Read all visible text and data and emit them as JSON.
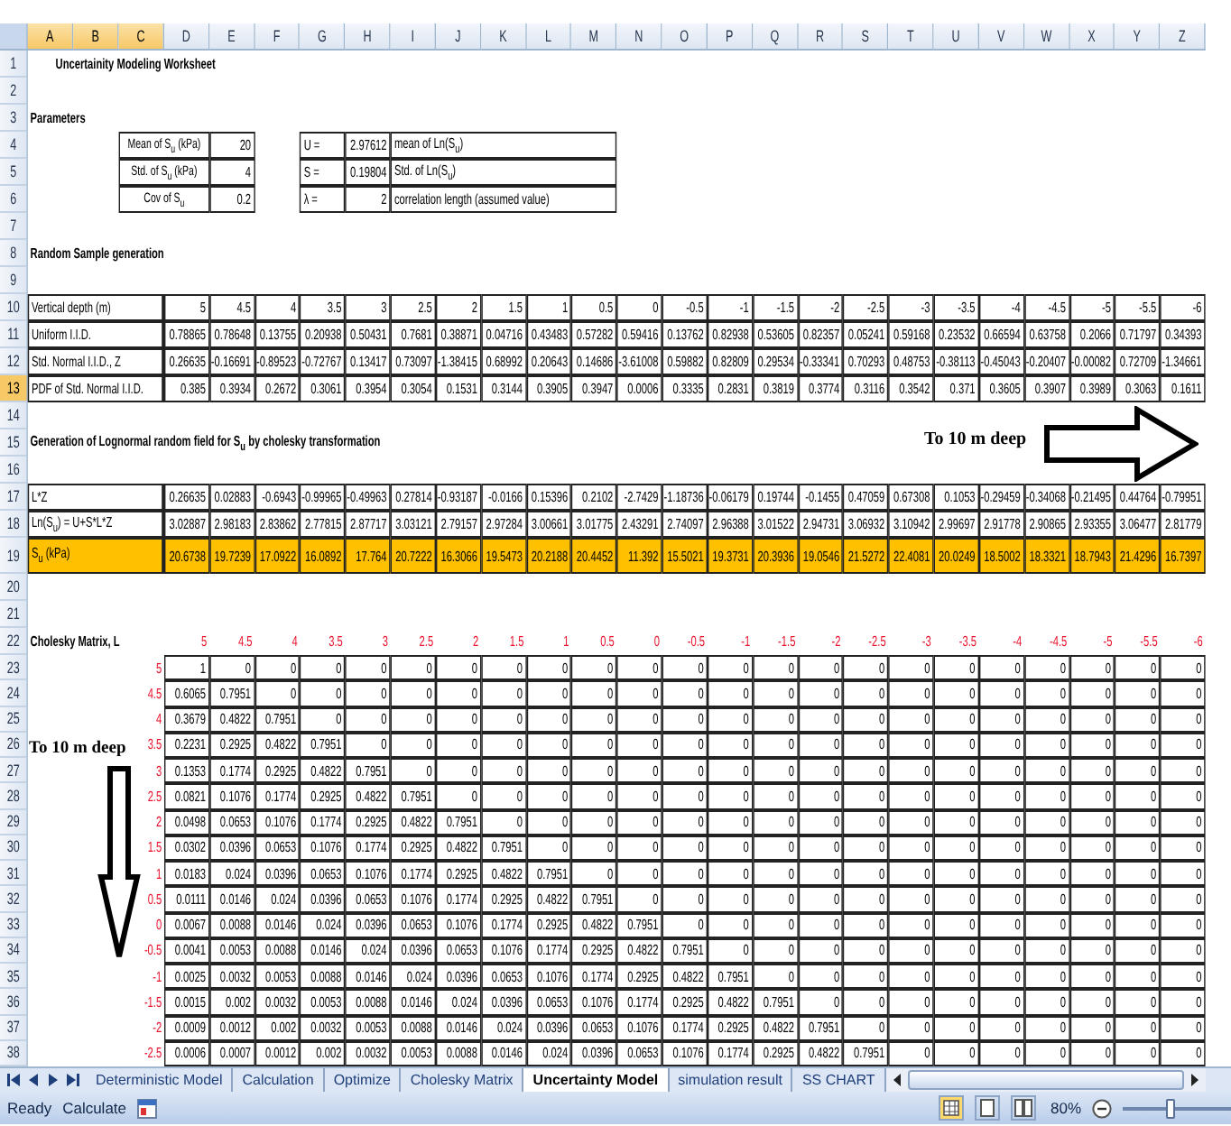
{
  "columns": [
    {
      "label": "A",
      "selected": true
    },
    {
      "label": "B",
      "selected": true
    },
    {
      "label": "C",
      "selected": true
    },
    {
      "label": "D",
      "selected": false
    },
    {
      "label": "E",
      "selected": false
    },
    {
      "label": "F",
      "selected": false
    },
    {
      "label": "G",
      "selected": false
    },
    {
      "label": "H",
      "selected": false
    },
    {
      "label": "I",
      "selected": false
    },
    {
      "label": "J",
      "selected": false
    },
    {
      "label": "K",
      "selected": false
    },
    {
      "label": "L",
      "selected": false
    },
    {
      "label": "M",
      "selected": false
    },
    {
      "label": "N",
      "selected": false
    },
    {
      "label": "O",
      "selected": false
    },
    {
      "label": "P",
      "selected": false
    },
    {
      "label": "Q",
      "selected": false
    },
    {
      "label": "R",
      "selected": false
    },
    {
      "label": "S",
      "selected": false
    },
    {
      "label": "T",
      "selected": false
    },
    {
      "label": "U",
      "selected": false
    },
    {
      "label": "V",
      "selected": false
    },
    {
      "label": "W",
      "selected": false
    },
    {
      "label": "X",
      "selected": false
    },
    {
      "label": "Y",
      "selected": false
    },
    {
      "label": "Z",
      "selected": false
    }
  ],
  "rows": [
    {
      "number": "1",
      "selected": false,
      "kind": "title",
      "text": "Uncertainity Modeling Worksheet"
    },
    {
      "number": "2",
      "selected": false,
      "kind": "blank"
    },
    {
      "number": "3",
      "selected": false,
      "kind": "section",
      "text": "Parameters"
    },
    {
      "number": "4",
      "selected": false,
      "kind": "params",
      "label": "Mean of S$_{u}$ (kPa)",
      "value": "20",
      "symbol": "U =",
      "symbol_value": "2.97612",
      "note": "mean of Ln(S$_{u}$)"
    },
    {
      "number": "5",
      "selected": false,
      "kind": "params",
      "label": "Std. of S$_{u}$ (kPa)",
      "value": "4",
      "symbol": "S =",
      "symbol_value": "0.19804",
      "note": "Std. of Ln(S$_{u}$)"
    },
    {
      "number": "6",
      "selected": false,
      "kind": "params",
      "label": "Cov of S$_{u}$",
      "value": "0.2",
      "symbol": "λ =",
      "symbol_value": "2",
      "note": "correlation length (assumed value)"
    },
    {
      "number": "7",
      "selected": false,
      "kind": "blank"
    },
    {
      "number": "8",
      "selected": false,
      "kind": "section",
      "text": "Random Sample generation"
    },
    {
      "number": "9",
      "selected": false,
      "kind": "blank"
    },
    {
      "number": "10",
      "selected": false,
      "kind": "data",
      "highlight": false,
      "label": "Vertical depth (m)",
      "values": [
        "5",
        "4.5",
        "4",
        "3.5",
        "3",
        "2.5",
        "2",
        "1.5",
        "1",
        "0.5",
        "0",
        "-0.5",
        "-1",
        "-1.5",
        "-2",
        "-2.5",
        "-3",
        "-3.5",
        "-4",
        "-4.5",
        "-5",
        "-5.5",
        "-6"
      ]
    },
    {
      "number": "11",
      "selected": false,
      "kind": "data",
      "highlight": false,
      "label": "Uniform I.I.D.",
      "values": [
        "0.78865",
        "0.78648",
        "0.13755",
        "0.20938",
        "0.50431",
        "0.7681",
        "0.38871",
        "0.04716",
        "0.43483",
        "0.57282",
        "0.59416",
        "0.13762",
        "0.82938",
        "0.53605",
        "0.82357",
        "0.05241",
        "0.59168",
        "0.23532",
        "0.66594",
        "0.63758",
        "0.2066",
        "0.71797",
        "0.34393"
      ]
    },
    {
      "number": "12",
      "selected": false,
      "kind": "data",
      "highlight": false,
      "label": "Std. Normal I.I.D., Z",
      "values": [
        "0.26635",
        "-0.16691",
        "-0.89523",
        "-0.72767",
        "0.13417",
        "0.73097",
        "-1.38415",
        "0.68992",
        "0.20643",
        "0.14686",
        "-3.61008",
        "0.59882",
        "0.82809",
        "0.29534",
        "-0.33341",
        "0.70293",
        "0.48753",
        "-0.38113",
        "-0.45043",
        "-0.20407",
        "-0.00082",
        "0.72709",
        "-1.34661"
      ]
    },
    {
      "number": "13",
      "selected": true,
      "kind": "data",
      "highlight": false,
      "label": "PDF of Std. Normal I.I.D.",
      "values": [
        "0.385",
        "0.3934",
        "0.2672",
        "0.3061",
        "0.3954",
        "0.3054",
        "0.1531",
        "0.3144",
        "0.3905",
        "0.3947",
        "0.0006",
        "0.3335",
        "0.2831",
        "0.3819",
        "0.3774",
        "0.3116",
        "0.3542",
        "0.371",
        "0.3605",
        "0.3907",
        "0.3989",
        "0.3063",
        "0.1611"
      ]
    },
    {
      "number": "14",
      "selected": false,
      "kind": "blank"
    },
    {
      "number": "15",
      "selected": false,
      "kind": "section",
      "text": "Generation of Lognormal random field for S$_{u}$ by cholesky transformation"
    },
    {
      "number": "16",
      "selected": false,
      "kind": "blank"
    },
    {
      "number": "17",
      "selected": false,
      "kind": "data",
      "highlight": false,
      "label": "L*Z",
      "values": [
        "0.26635",
        "0.02883",
        "-0.6943",
        "-0.99965",
        "-0.49963",
        "0.27814",
        "-0.93187",
        "-0.0166",
        "0.15396",
        "0.2102",
        "-2.7429",
        "-1.18736",
        "-0.06179",
        "0.19744",
        "-0.1455",
        "0.47059",
        "0.67308",
        "0.1053",
        "-0.29459",
        "-0.34068",
        "-0.21495",
        "0.44764",
        "-0.79951"
      ]
    },
    {
      "number": "18",
      "selected": false,
      "kind": "data",
      "highlight": false,
      "label": "Ln(S$_{u}$) = U+S*L*Z",
      "values": [
        "3.02887",
        "2.98183",
        "2.83862",
        "2.77815",
        "2.87717",
        "3.03121",
        "2.79157",
        "2.97284",
        "3.00661",
        "3.01775",
        "2.43291",
        "2.74097",
        "2.96388",
        "3.01522",
        "2.94731",
        "3.06932",
        "3.10942",
        "2.99697",
        "2.91778",
        "2.90865",
        "2.93355",
        "3.06477",
        "2.81779"
      ]
    },
    {
      "number": "19",
      "selected": false,
      "kind": "data",
      "highlight": true,
      "label": "S$_{u}$ (kPa)",
      "values": [
        "20.6738",
        "19.7239",
        "17.0922",
        "16.0892",
        "17.764",
        "20.7222",
        "16.3066",
        "19.5473",
        "20.2188",
        "20.4452",
        "11.392",
        "15.5021",
        "19.3731",
        "20.3936",
        "19.0546",
        "21.5272",
        "22.4081",
        "20.0249",
        "18.5002",
        "18.3321",
        "18.7943",
        "21.4296",
        "16.7397"
      ]
    },
    {
      "number": "20",
      "selected": false,
      "kind": "blank"
    },
    {
      "number": "21",
      "selected": false,
      "kind": "blank"
    },
    {
      "number": "22",
      "selected": false,
      "kind": "depths",
      "label": "Cholesky Matrix, L",
      "values": [
        "5",
        "4.5",
        "4",
        "3.5",
        "3",
        "2.5",
        "2",
        "1.5",
        "1",
        "0.5",
        "0",
        "-0.5",
        "-1",
        "-1.5",
        "-2",
        "-2.5",
        "-3",
        "-3.5",
        "-4",
        "-4.5",
        "-5",
        "-5.5",
        "-6"
      ]
    },
    {
      "number": "23",
      "selected": false,
      "kind": "matrix",
      "depth": "5",
      "values": [
        "1",
        "0",
        "0",
        "0",
        "0",
        "0",
        "0",
        "0",
        "0",
        "0",
        "0",
        "0",
        "0",
        "0",
        "0",
        "0",
        "0",
        "0",
        "0",
        "0",
        "0",
        "0",
        "0"
      ]
    },
    {
      "number": "24",
      "selected": false,
      "kind": "matrix",
      "depth": "4.5",
      "values": [
        "0.6065",
        "0.7951",
        "0",
        "0",
        "0",
        "0",
        "0",
        "0",
        "0",
        "0",
        "0",
        "0",
        "0",
        "0",
        "0",
        "0",
        "0",
        "0",
        "0",
        "0",
        "0",
        "0",
        "0"
      ]
    },
    {
      "number": "25",
      "selected": false,
      "kind": "matrix",
      "depth": "4",
      "values": [
        "0.3679",
        "0.4822",
        "0.7951",
        "0",
        "0",
        "0",
        "0",
        "0",
        "0",
        "0",
        "0",
        "0",
        "0",
        "0",
        "0",
        "0",
        "0",
        "0",
        "0",
        "0",
        "0",
        "0",
        "0"
      ]
    },
    {
      "number": "26",
      "selected": false,
      "kind": "matrix",
      "depth": "3.5",
      "values": [
        "0.2231",
        "0.2925",
        "0.4822",
        "0.7951",
        "0",
        "0",
        "0",
        "0",
        "0",
        "0",
        "0",
        "0",
        "0",
        "0",
        "0",
        "0",
        "0",
        "0",
        "0",
        "0",
        "0",
        "0",
        "0"
      ]
    },
    {
      "number": "27",
      "selected": false,
      "kind": "matrix",
      "depth": "3",
      "values": [
        "0.1353",
        "0.1774",
        "0.2925",
        "0.4822",
        "0.7951",
        "0",
        "0",
        "0",
        "0",
        "0",
        "0",
        "0",
        "0",
        "0",
        "0",
        "0",
        "0",
        "0",
        "0",
        "0",
        "0",
        "0",
        "0"
      ]
    },
    {
      "number": "28",
      "selected": false,
      "kind": "matrix",
      "depth": "2.5",
      "values": [
        "0.0821",
        "0.1076",
        "0.1774",
        "0.2925",
        "0.4822",
        "0.7951",
        "0",
        "0",
        "0",
        "0",
        "0",
        "0",
        "0",
        "0",
        "0",
        "0",
        "0",
        "0",
        "0",
        "0",
        "0",
        "0",
        "0"
      ]
    },
    {
      "number": "29",
      "selected": false,
      "kind": "matrix",
      "depth": "2",
      "values": [
        "0.0498",
        "0.0653",
        "0.1076",
        "0.1774",
        "0.2925",
        "0.4822",
        "0.7951",
        "0",
        "0",
        "0",
        "0",
        "0",
        "0",
        "0",
        "0",
        "0",
        "0",
        "0",
        "0",
        "0",
        "0",
        "0",
        "0"
      ]
    },
    {
      "number": "30",
      "selected": false,
      "kind": "matrix",
      "depth": "1.5",
      "values": [
        "0.0302",
        "0.0396",
        "0.0653",
        "0.1076",
        "0.1774",
        "0.2925",
        "0.4822",
        "0.7951",
        "0",
        "0",
        "0",
        "0",
        "0",
        "0",
        "0",
        "0",
        "0",
        "0",
        "0",
        "0",
        "0",
        "0",
        "0"
      ]
    },
    {
      "number": "31",
      "selected": false,
      "kind": "matrix",
      "depth": "1",
      "values": [
        "0.0183",
        "0.024",
        "0.0396",
        "0.0653",
        "0.1076",
        "0.1774",
        "0.2925",
        "0.4822",
        "0.7951",
        "0",
        "0",
        "0",
        "0",
        "0",
        "0",
        "0",
        "0",
        "0",
        "0",
        "0",
        "0",
        "0",
        "0"
      ]
    },
    {
      "number": "32",
      "selected": false,
      "kind": "matrix",
      "depth": "0.5",
      "values": [
        "0.0111",
        "0.0146",
        "0.024",
        "0.0396",
        "0.0653",
        "0.1076",
        "0.1774",
        "0.2925",
        "0.4822",
        "0.7951",
        "0",
        "0",
        "0",
        "0",
        "0",
        "0",
        "0",
        "0",
        "0",
        "0",
        "0",
        "0",
        "0"
      ]
    },
    {
      "number": "33",
      "selected": false,
      "kind": "matrix",
      "depth": "0",
      "values": [
        "0.0067",
        "0.0088",
        "0.0146",
        "0.024",
        "0.0396",
        "0.0653",
        "0.1076",
        "0.1774",
        "0.2925",
        "0.4822",
        "0.7951",
        "0",
        "0",
        "0",
        "0",
        "0",
        "0",
        "0",
        "0",
        "0",
        "0",
        "0",
        "0"
      ]
    },
    {
      "number": "34",
      "selected": false,
      "kind": "matrix",
      "depth": "-0.5",
      "values": [
        "0.0041",
        "0.0053",
        "0.0088",
        "0.0146",
        "0.024",
        "0.0396",
        "0.0653",
        "0.1076",
        "0.1774",
        "0.2925",
        "0.4822",
        "0.7951",
        "0",
        "0",
        "0",
        "0",
        "0",
        "0",
        "0",
        "0",
        "0",
        "0",
        "0"
      ]
    },
    {
      "number": "35",
      "selected": false,
      "kind": "matrix",
      "depth": "-1",
      "values": [
        "0.0025",
        "0.0032",
        "0.0053",
        "0.0088",
        "0.0146",
        "0.024",
        "0.0396",
        "0.0653",
        "0.1076",
        "0.1774",
        "0.2925",
        "0.4822",
        "0.7951",
        "0",
        "0",
        "0",
        "0",
        "0",
        "0",
        "0",
        "0",
        "0",
        "0"
      ]
    },
    {
      "number": "36",
      "selected": false,
      "kind": "matrix",
      "depth": "-1.5",
      "values": [
        "0.0015",
        "0.002",
        "0.0032",
        "0.0053",
        "0.0088",
        "0.0146",
        "0.024",
        "0.0396",
        "0.0653",
        "0.1076",
        "0.1774",
        "0.2925",
        "0.4822",
        "0.7951",
        "0",
        "0",
        "0",
        "0",
        "0",
        "0",
        "0",
        "0",
        "0"
      ]
    },
    {
      "number": "37",
      "selected": false,
      "kind": "matrix",
      "depth": "-2",
      "values": [
        "0.0009",
        "0.0012",
        "0.002",
        "0.0032",
        "0.0053",
        "0.0088",
        "0.0146",
        "0.024",
        "0.0396",
        "0.0653",
        "0.1076",
        "0.1774",
        "0.2925",
        "0.4822",
        "0.7951",
        "0",
        "0",
        "0",
        "0",
        "0",
        "0",
        "0",
        "0"
      ]
    },
    {
      "number": "38",
      "selected": false,
      "kind": "matrix",
      "depth": "-2.5",
      "values": [
        "0.0006",
        "0.0007",
        "0.0012",
        "0.002",
        "0.0032",
        "0.0053",
        "0.0088",
        "0.0146",
        "0.024",
        "0.0396",
        "0.0653",
        "0.1076",
        "0.1774",
        "0.2925",
        "0.4822",
        "0.7951",
        "0",
        "0",
        "0",
        "0",
        "0",
        "0",
        "0"
      ]
    }
  ],
  "annotations": [
    {
      "kind": "right",
      "text": "To 10 m deep"
    },
    {
      "kind": "down",
      "text": "To 10 m deep"
    }
  ],
  "tabs": [
    {
      "label": "Deterministic Model",
      "selected": false
    },
    {
      "label": "Calculation",
      "selected": false
    },
    {
      "label": "Optimize",
      "selected": false
    },
    {
      "label": "Cholesky Matrix",
      "selected": false
    },
    {
      "label": "Uncertainty Model",
      "selected": true
    },
    {
      "label": "simulation result",
      "selected": false
    },
    {
      "label": "SS CHART",
      "selected": false
    }
  ],
  "status_bar": {
    "state": "Ready",
    "mode": "Calculate",
    "zoom": {
      "text": "80%",
      "level": 0.42
    }
  }
}
